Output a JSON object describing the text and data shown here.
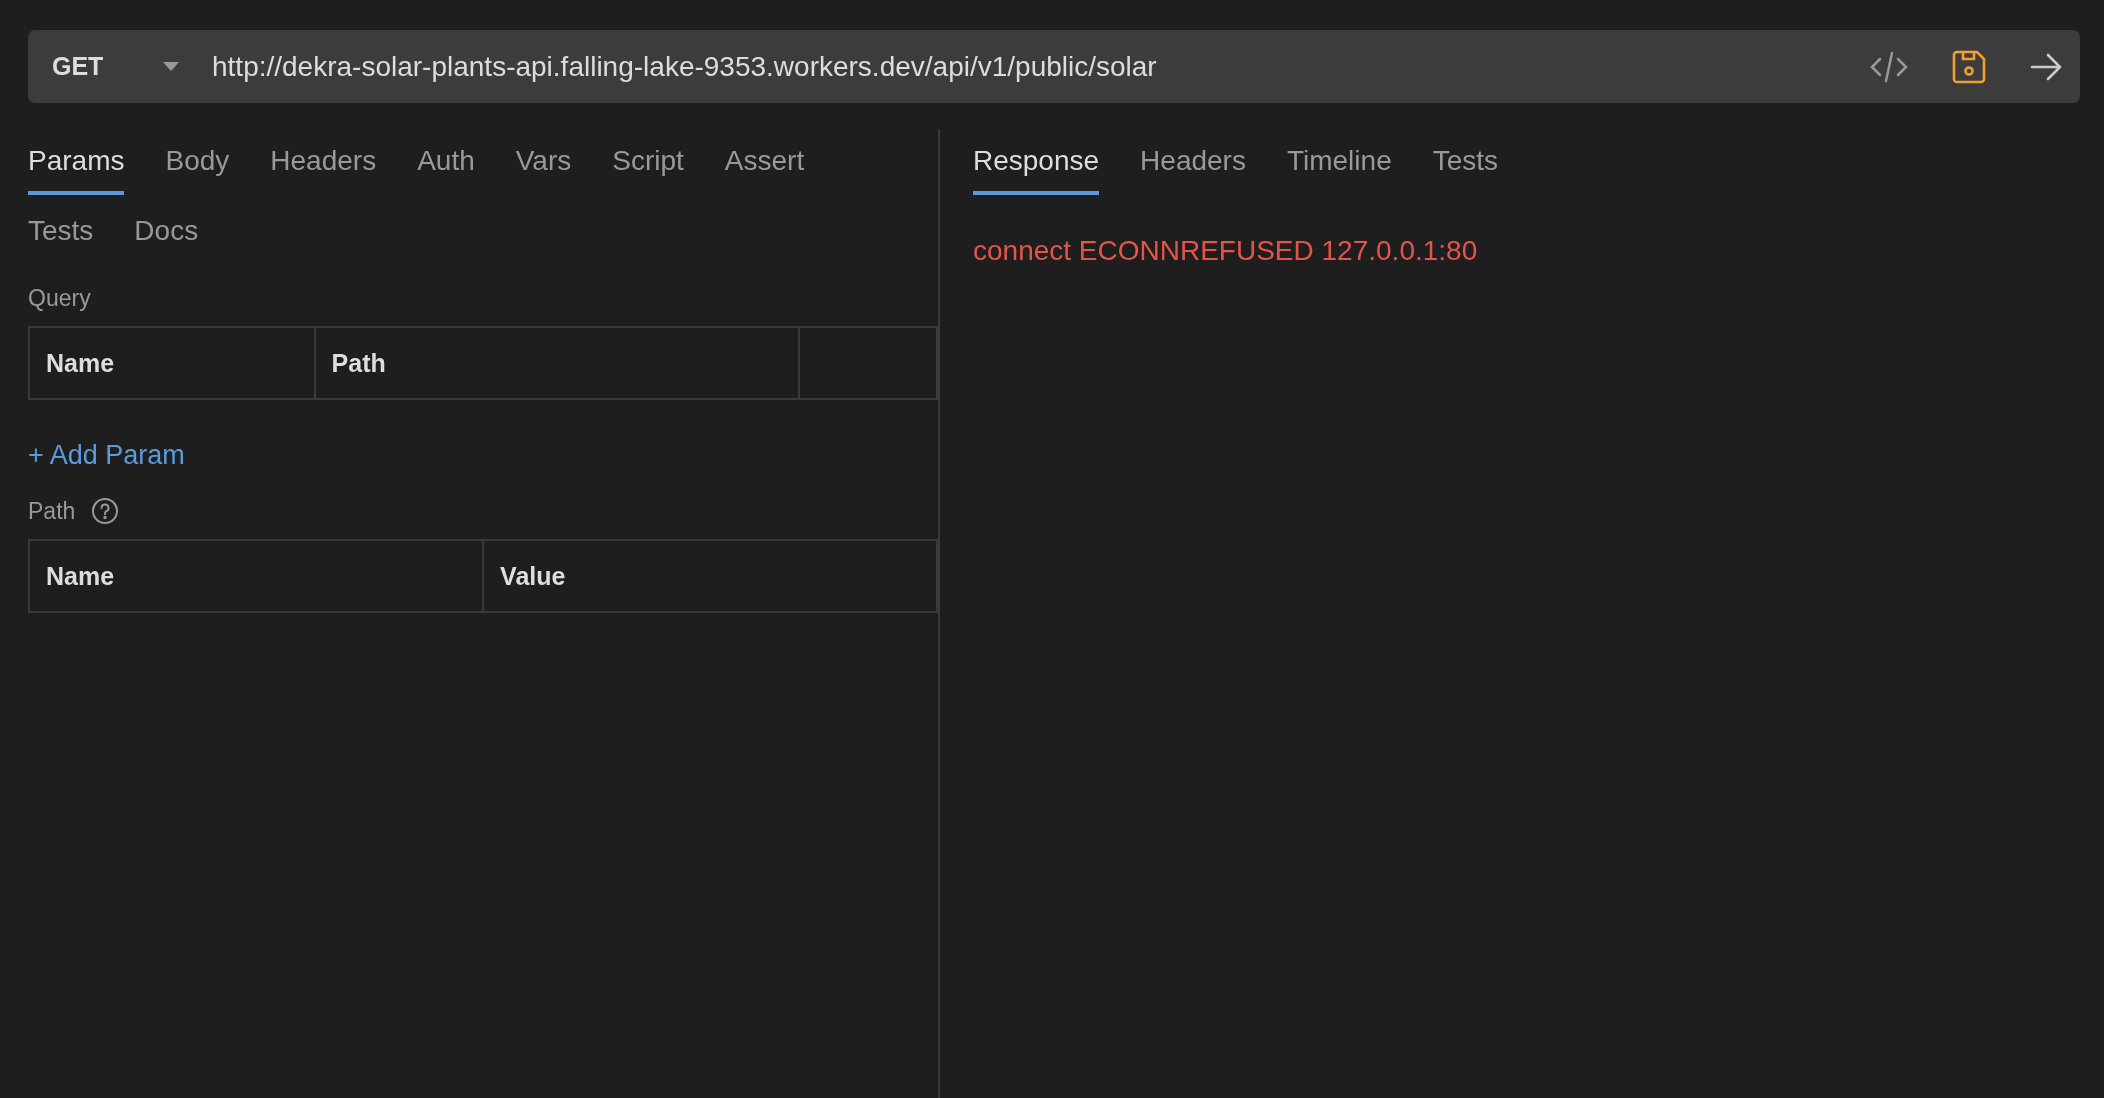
{
  "request_bar": {
    "method": "GET",
    "url": "http://dekra-solar-plants-api.falling-lake-9353.workers.dev/api/v1/public/solar"
  },
  "request_tabs": [
    {
      "label": "Params",
      "selected": true
    },
    {
      "label": "Body",
      "selected": false
    },
    {
      "label": "Headers",
      "selected": false
    },
    {
      "label": "Auth",
      "selected": false
    },
    {
      "label": "Vars",
      "selected": false
    },
    {
      "label": "Script",
      "selected": false
    },
    {
      "label": "Assert",
      "selected": false
    },
    {
      "label": "Tests",
      "selected": false
    },
    {
      "label": "Docs",
      "selected": false
    }
  ],
  "query": {
    "title": "Query",
    "columns": [
      "Name",
      "Path",
      ""
    ],
    "add_link": "+ Add Param"
  },
  "path": {
    "title": "Path",
    "columns": [
      "Name",
      "Value"
    ]
  },
  "response_tabs": [
    {
      "label": "Response",
      "selected": true
    },
    {
      "label": "Headers",
      "selected": false
    },
    {
      "label": "Timeline",
      "selected": false
    },
    {
      "label": "Tests",
      "selected": false
    }
  ],
  "error": "connect ECONNREFUSED 127.0.0.1:80"
}
